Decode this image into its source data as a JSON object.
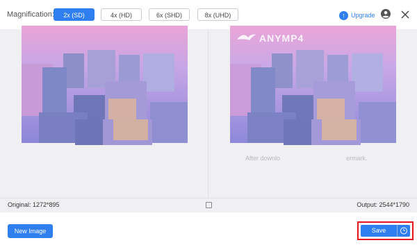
{
  "header": {
    "magnification_label": "Magnification:",
    "options": [
      {
        "label": "2x (SD)",
        "active": true
      },
      {
        "label": "4x (HD)",
        "active": false
      },
      {
        "label": "6x (SHD)",
        "active": false
      },
      {
        "label": "8x (UHD)",
        "active": false
      }
    ],
    "upgrade_label": "Upgrade",
    "icons": [
      "upgrade-icon",
      "account-icon",
      "close-icon"
    ]
  },
  "preview": {
    "watermark_text": "ANYMP4",
    "watermark_note_left": "After downlo",
    "watermark_note_right": "ermark."
  },
  "info": {
    "original": "Original: 1272*895",
    "output": "Output: 2544*1790"
  },
  "footer": {
    "new_image_label": "New Image",
    "save_label": "Save"
  },
  "colors": {
    "accent": "#2f7ff0",
    "highlight_border": "#e8151d",
    "preview_bg": "#f0f0f2"
  }
}
